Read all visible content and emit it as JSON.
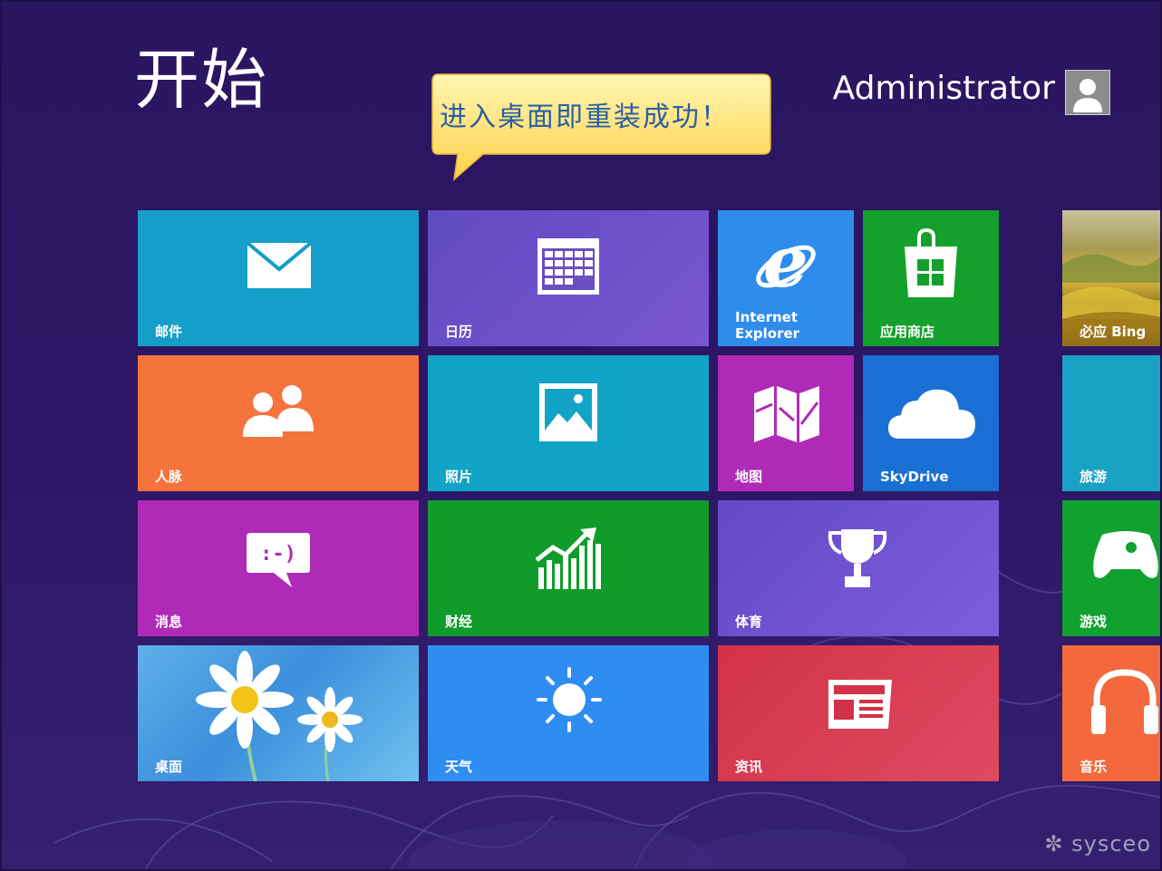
{
  "start": {
    "title": "开始"
  },
  "user": {
    "name": "Administrator",
    "avatar_icon": "user-avatar-icon"
  },
  "callout": {
    "text": "进入桌面即重装成功！",
    "bg_top": "#fff4a8",
    "bg_bottom": "#ffd24a"
  },
  "tiles": {
    "mail": {
      "label": "邮件",
      "icon": "mail-icon",
      "color": "#159fc8"
    },
    "calendar": {
      "label": "日历",
      "icon": "calendar-icon",
      "color": "#6a4fc3"
    },
    "ie": {
      "label_line1": "Internet",
      "label_line2": "Explorer",
      "icon": "internet-explorer-icon",
      "color": "#2e8cea"
    },
    "store": {
      "label": "应用商店",
      "icon": "store-icon",
      "color": "#14a02c"
    },
    "bing": {
      "label": "必应 Bing",
      "icon": "bing-landscape-image"
    },
    "people": {
      "label": "人脉",
      "icon": "people-icon",
      "color": "#f5733c"
    },
    "photos": {
      "label": "照片",
      "icon": "photos-icon",
      "color": "#12a4c6"
    },
    "maps": {
      "label": "地图",
      "icon": "map-icon",
      "color": "#b02ab8"
    },
    "skydrive": {
      "label": "SkyDrive",
      "icon": "cloud-icon",
      "color": "#1a6fd4"
    },
    "travel": {
      "label": "旅游",
      "icon": "travel-image",
      "color": "#1aa2c5"
    },
    "messaging": {
      "label": "消息",
      "icon": "chat-bubble-icon",
      "color": "#b02ab8"
    },
    "finance": {
      "label": "财经",
      "icon": "finance-chart-icon",
      "color": "#0f9c2a"
    },
    "sports": {
      "label": "体育",
      "icon": "trophy-icon",
      "color": "#6d52cf"
    },
    "games": {
      "label": "游戏",
      "icon": "xbox-controller-icon",
      "color": "#11a12f"
    },
    "desktop": {
      "label": "桌面",
      "icon": "daisy-wallpaper-image"
    },
    "weather": {
      "label": "天气",
      "icon": "sun-icon",
      "color": "#2f8df2"
    },
    "news": {
      "label": "资讯",
      "icon": "newspaper-icon",
      "color": "#d93b52"
    },
    "music": {
      "label": "音乐",
      "icon": "headphones-icon",
      "color": "#f3693d"
    }
  },
  "watermark": {
    "text": "sysceo"
  }
}
